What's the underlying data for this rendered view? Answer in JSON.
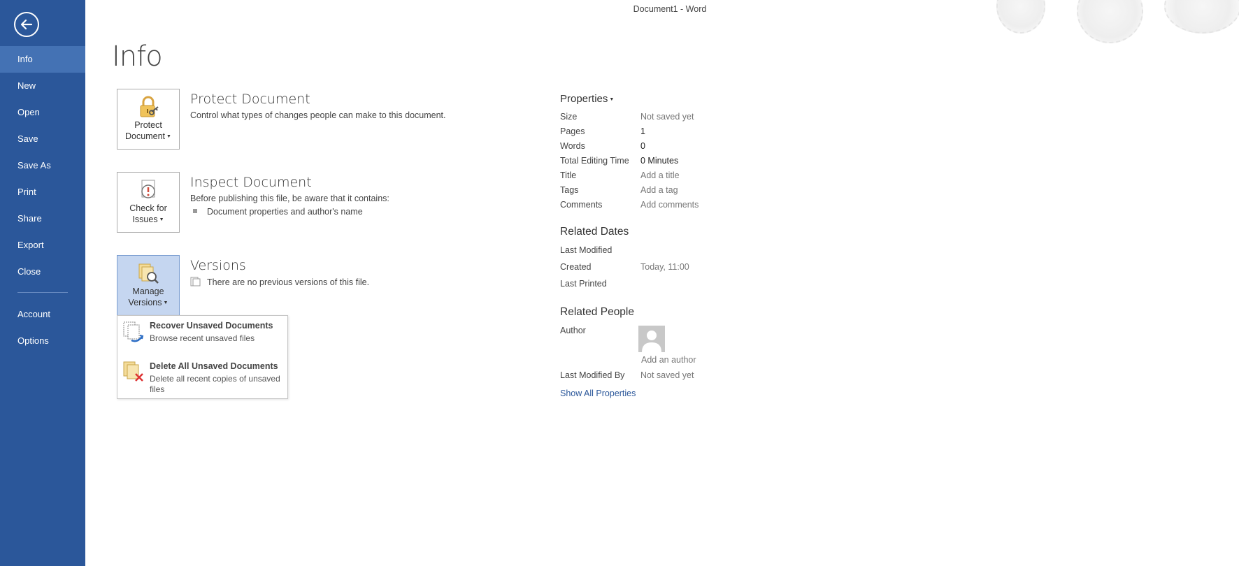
{
  "window": {
    "title": "Document1 - Word"
  },
  "sidebar": {
    "items": [
      {
        "label": "Info",
        "active": true
      },
      {
        "label": "New"
      },
      {
        "label": "Open"
      },
      {
        "label": "Save"
      },
      {
        "label": "Save As"
      },
      {
        "label": "Print"
      },
      {
        "label": "Share"
      },
      {
        "label": "Export"
      },
      {
        "label": "Close"
      }
    ],
    "bottom_items": [
      {
        "label": "Account"
      },
      {
        "label": "Options"
      }
    ]
  },
  "page": {
    "title": "Info"
  },
  "protect": {
    "button_line1": "Protect",
    "button_line2": "Document",
    "title": "Protect Document",
    "description": "Control what types of changes people can make to this document."
  },
  "inspect": {
    "button_line1": "Check for",
    "button_line2": "Issues",
    "title": "Inspect Document",
    "description": "Before publishing this file, be aware that it contains:",
    "bullets": [
      "Document properties and author's name"
    ]
  },
  "versions": {
    "button_line1": "Manage",
    "button_line2": "Versions",
    "title": "Versions",
    "description": "There are no previous versions of this file."
  },
  "manage_menu": {
    "items": [
      {
        "title": "Recover Unsaved Documents",
        "description": "Browse recent unsaved files"
      },
      {
        "title": "Delete All Unsaved Documents",
        "description": "Delete all recent copies of unsaved files"
      }
    ]
  },
  "properties": {
    "title": "Properties",
    "rows": [
      {
        "label": "Size",
        "value": "Not saved yet"
      },
      {
        "label": "Pages",
        "value": "1"
      },
      {
        "label": "Words",
        "value": "0"
      },
      {
        "label": "Total Editing Time",
        "value": "0 Minutes"
      },
      {
        "label": "Title",
        "value": "Add a title"
      },
      {
        "label": "Tags",
        "value": "Add a tag"
      },
      {
        "label": "Comments",
        "value": "Add comments"
      }
    ]
  },
  "related_dates": {
    "title": "Related Dates",
    "rows": [
      {
        "label": "Last Modified",
        "value": ""
      },
      {
        "label": "Created",
        "value": "Today, 11:00"
      },
      {
        "label": "Last Printed",
        "value": ""
      }
    ]
  },
  "related_people": {
    "title": "Related People",
    "author_label": "Author",
    "add_author": "Add an author",
    "last_modified_by_label": "Last Modified By",
    "last_modified_by_value": "Not saved yet"
  },
  "show_all_properties": "Show All Properties",
  "colors": {
    "sidebar": "#2b579a",
    "sidebar_active": "#4472b4",
    "link": "#2b579a",
    "selected_tile": "#c5d6f0"
  }
}
